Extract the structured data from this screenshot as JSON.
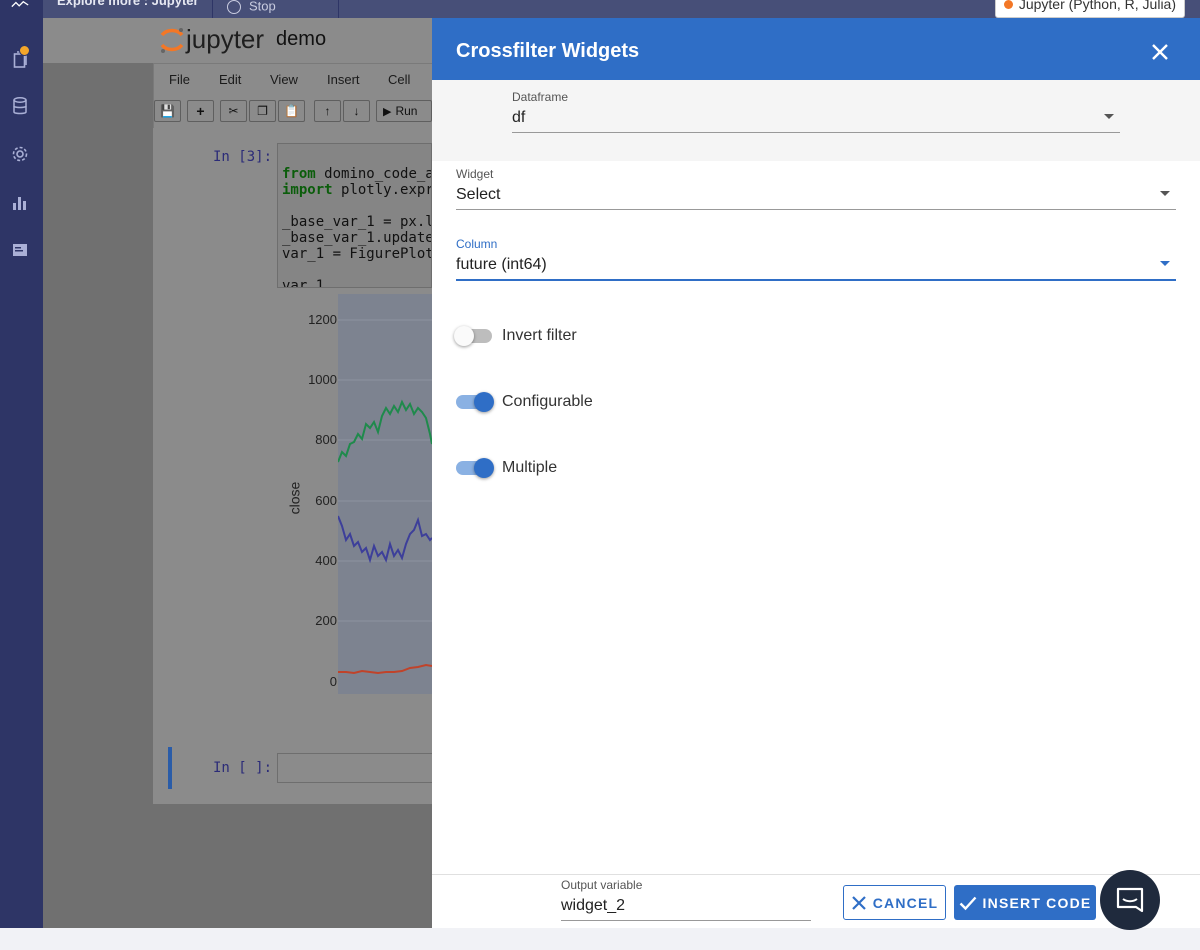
{
  "topbar": {
    "tab_title": "Explore more : Jupyter",
    "stop_label": "Stop",
    "kernel": "Jupyter (Python, R, Julia)"
  },
  "notebook": {
    "logo_text": "jupyter",
    "name": "demo",
    "menu": [
      "File",
      "Edit",
      "View",
      "Insert",
      "Cell"
    ],
    "run_label": "Run",
    "prompt_in3": "In [3]:",
    "prompt_empty": "In [ ]:",
    "code_lines": [
      "from domino_code_a",
      "import plotly.expr",
      "",
      "_base_var_1 = px.l",
      "_base_var_1.update",
      "var_1 = FigurePlot",
      "",
      "var_1"
    ],
    "plot_ylabel": "close",
    "plot_yticks": [
      "1200",
      "1000",
      "800",
      "600",
      "400",
      "200",
      "0"
    ]
  },
  "dialog": {
    "title": "Crossfilter Widgets",
    "dataframe": {
      "label": "Dataframe",
      "value": "df"
    },
    "widget": {
      "label": "Widget",
      "value": "Select"
    },
    "column": {
      "label": "Column",
      "value": "future (int64)"
    },
    "toggles": [
      {
        "label": "Invert filter",
        "on": false
      },
      {
        "label": "Configurable",
        "on": true
      },
      {
        "label": "Multiple",
        "on": true
      }
    ],
    "output": {
      "label": "Output variable",
      "value": "widget_2"
    },
    "cancel_label": "CANCEL",
    "insert_label": "INSERT CODE"
  },
  "colors": {
    "accent": "#2f6ec6",
    "rail": "#2e3566",
    "series_green": "#1f8a4c",
    "series_blue": "#3d3f9a",
    "series_red": "#c0432a"
  }
}
